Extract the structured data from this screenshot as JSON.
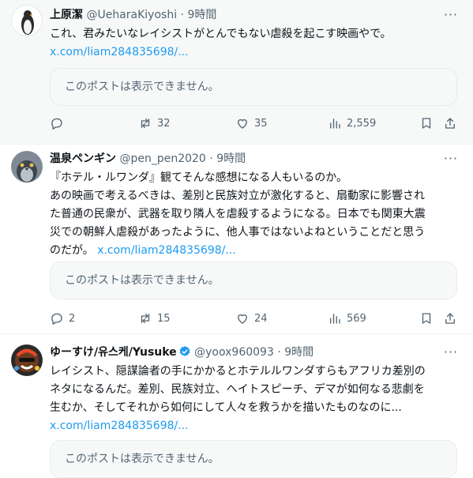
{
  "posts": [
    {
      "name": "上原潔",
      "handle": "@UeharaKiyoshi",
      "dot": "·",
      "time": "9時間",
      "lines": [
        "これ、君みたいなレイシストがとんでもない虐殺を起こす映画やで。"
      ],
      "link": "x.com/liam284835698/...",
      "card_text": "このポストは表示できません。",
      "replies": "",
      "reposts": "32",
      "likes": "35",
      "views": "2,559"
    },
    {
      "name": "温泉ペンギン",
      "handle": "@pen_pen2020",
      "dot": "·",
      "time": "9時間",
      "lines": [
        "『ホテル・ルワンダ』観てそんな感想になる人もいるのか。",
        "あの映画で考えるべきは、差別と民族対立が激化すると、扇動家に影響され",
        "た普通の民衆が、武器を取り隣人を虐殺するようになる。日本でも関東大震",
        "災での朝鮮人虐殺があったように、他人事ではないよねということだと思う",
        "のだが。"
      ],
      "link": "x.com/liam284835698/...",
      "card_text": "このポストは表示できません。",
      "replies": "2",
      "reposts": "15",
      "likes": "24",
      "views": "569"
    },
    {
      "name": "ゆーすけ/유스케/Yusuke",
      "handle": "@yoox960093",
      "dot": "·",
      "time": "9時間",
      "lines": [
        "レイシスト、隠謀論者の手にかかるとホテルルワンダすらもアフリカ差別の",
        "ネタになるんだ。差別、民族対立、ヘイトスピーチ、デマが如何なる悲劇を",
        "生むか、そしてそれから如何にして人々を救うかを描いたものなのに..."
      ],
      "link": "x.com/liam284835698/...",
      "card_text": "このポストは表示できません。"
    }
  ],
  "colors": {
    "link": "#1d9bf0",
    "muted": "#536471",
    "verified": "#1d9bf0"
  },
  "icons": [
    "reply-icon",
    "repost-icon",
    "like-icon",
    "views-icon",
    "bookmark-icon",
    "share-icon",
    "more-icon",
    "verified-badge-icon"
  ]
}
